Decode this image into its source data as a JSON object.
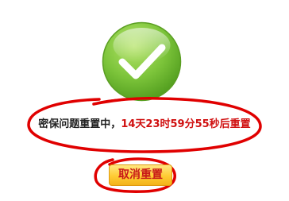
{
  "message": {
    "prefix": "密保问题重置中，",
    "countdown": "14天23时59分55秒后重置"
  },
  "cancel_button": {
    "label": "取消重置"
  },
  "icons": {
    "status": "check-circle-icon"
  },
  "colors": {
    "success_green": "#6fbf2a",
    "countdown_red": "#d01010",
    "annotation_red": "#e00000",
    "button_yellow": "#ffcc33"
  }
}
